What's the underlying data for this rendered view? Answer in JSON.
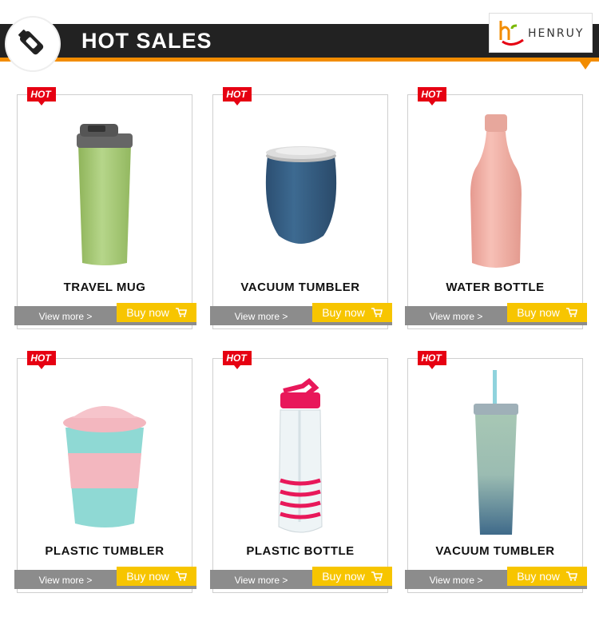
{
  "header": {
    "title": "HOT SALES",
    "logo_text": "HENRUY",
    "icon": "usb-bottle-icon",
    "colors": {
      "bar": "#222222",
      "accent": "#f28c00"
    }
  },
  "buttons": {
    "view_more": "View more >",
    "buy_now": "Buy now",
    "buy_icon": "cart-icon"
  },
  "badge": {
    "label": "HOT",
    "color": "#e60012"
  },
  "products": [
    {
      "name": "TRAVEL MUG",
      "image": "travel-mug-image"
    },
    {
      "name": "VACUUM TUMBLER",
      "image": "vacuum-tumbler-image"
    },
    {
      "name": "WATER BOTTLE",
      "image": "water-bottle-image"
    },
    {
      "name": "PLASTIC TUMBLER",
      "image": "plastic-tumbler-image"
    },
    {
      "name": "PLASTIC BOTTLE",
      "image": "plastic-bottle-image"
    },
    {
      "name": "VACUUM TUMBLER",
      "image": "vacuum-tumbler-straw-image"
    }
  ]
}
